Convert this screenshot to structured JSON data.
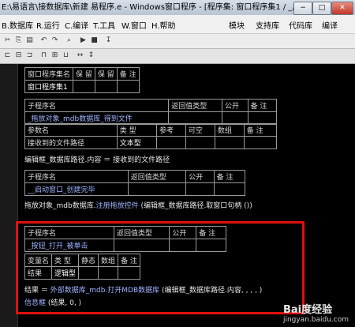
{
  "window": {
    "title": "E:\\易语言\\接数据库\\新建 易程序.e - Windows窗口程序 - [程序集: 窗口程序集1 / _启动窗口]",
    "btn_min": "−",
    "btn_max": "□",
    "btn_close": "✕"
  },
  "menubar": {
    "items": [
      "B.数据库",
      "R.运行",
      "C.编译",
      "T.工具",
      "W.窗口",
      "H.帮助"
    ],
    "right": [
      "模块",
      "支持库",
      "代码库",
      "编译"
    ]
  },
  "tables": {
    "asm": {
      "h": [
        "窗口程序集名",
        "保 留",
        "保 留",
        "备 注"
      ],
      "name": "窗口程序集1"
    },
    "sub1": {
      "h": [
        "子程序名",
        "返回值类型",
        "公开",
        "备 注"
      ],
      "name": "_拖放对象_mdb数据库_得到文件",
      "ph": [
        "参数名",
        "类 型",
        "参考",
        "可空",
        "数组",
        "备 注"
      ],
      "pname": "接收到的文件路径",
      "ptype": "文本型"
    },
    "sub2": {
      "h": [
        "子程序名",
        "返回值类型",
        "公开",
        "备 注"
      ],
      "name": "__启动窗口_创建完毕"
    },
    "sub3": {
      "h": [
        "子程序名",
        "返回值类型",
        "公开",
        "备 注"
      ],
      "name": "_按钮_打开_被单击",
      "vh": [
        "变量名",
        "类 型",
        "静态",
        "数组",
        "备 注"
      ],
      "vname": "结果",
      "vtype": "逻辑型"
    }
  },
  "code": {
    "l1": "编辑框_数据库路径.内容 ＝ 接收到的文件路径",
    "l2a": "拖放对象_mdb数据库.",
    "l2b": "注册拖放控件",
    "l2c": " (编辑框_数据库路径.取窗口句柄 ())",
    "l3a": "结果 ＝ ",
    "l3b": "外部数据库_mdb.",
    "l3c": "打开MDB数据库",
    "l3d": " (编辑框_数据库路径.内容, , , , )",
    "l4a": "信息框",
    "l4b": " (结果, 0, )"
  },
  "watermark": {
    "brand": "Bai度经验",
    "url": "jingyan.baidu.com"
  }
}
